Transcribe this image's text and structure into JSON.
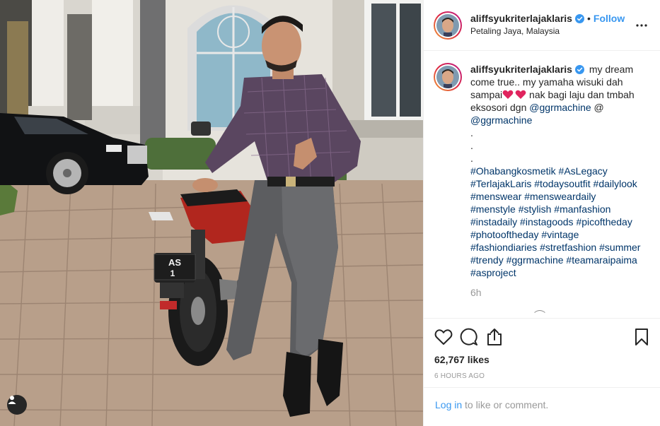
{
  "post": {
    "username": "aliffsyukriterlajaklaris",
    "verified": true,
    "follow_label": "Follow",
    "separator": "•",
    "location": "Petaling Jaya, Malaysia"
  },
  "photo": {
    "plate_line1": "AS",
    "plate_line2": "1"
  },
  "caption": {
    "username": "aliffsyukriterlajaklaris",
    "text_part1": "my dream come true.. my yamaha wisuki dah sampai",
    "hearts": [
      "heart",
      "heart"
    ],
    "text_part2": "nak bagi laju dan tmbah eksosori dgn",
    "mention1": "@ggrmachine",
    "mention2": "@ ",
    "mention3": "@ggrmachine",
    "dots": [
      ".",
      ".",
      "."
    ],
    "hashtags": [
      "#Ohabangkosmetik",
      "#AsLegacy",
      "#TerlajakLaris",
      "#todaysoutfit",
      "#dailylook",
      "#menswear",
      "#mensweardaily",
      "#menstyle",
      "#stylish",
      "#manfashion",
      "#instadaily",
      "#instagoods",
      "#picoftheday",
      "#photooftheday",
      "#vintage",
      "#fashiondiaries",
      "#stretfashion",
      "#summer",
      "#trendy",
      "#ggrmachine",
      "#teamaraipaima",
      "#asproject"
    ],
    "time": "6h"
  },
  "actions": {
    "like_icon": "heart-outline-icon",
    "comment_icon": "comment-icon",
    "share_icon": "share-icon",
    "save_icon": "bookmark-icon"
  },
  "likes_text": "62,767 likes",
  "timestamp": "6 HOURS AGO",
  "login": {
    "link": "Log in",
    "rest": " to like or comment."
  },
  "colors": {
    "link_blue": "#3897f0",
    "hashtag_blue": "#003569",
    "muted": "#999999",
    "heart_red": "#e0245e"
  }
}
